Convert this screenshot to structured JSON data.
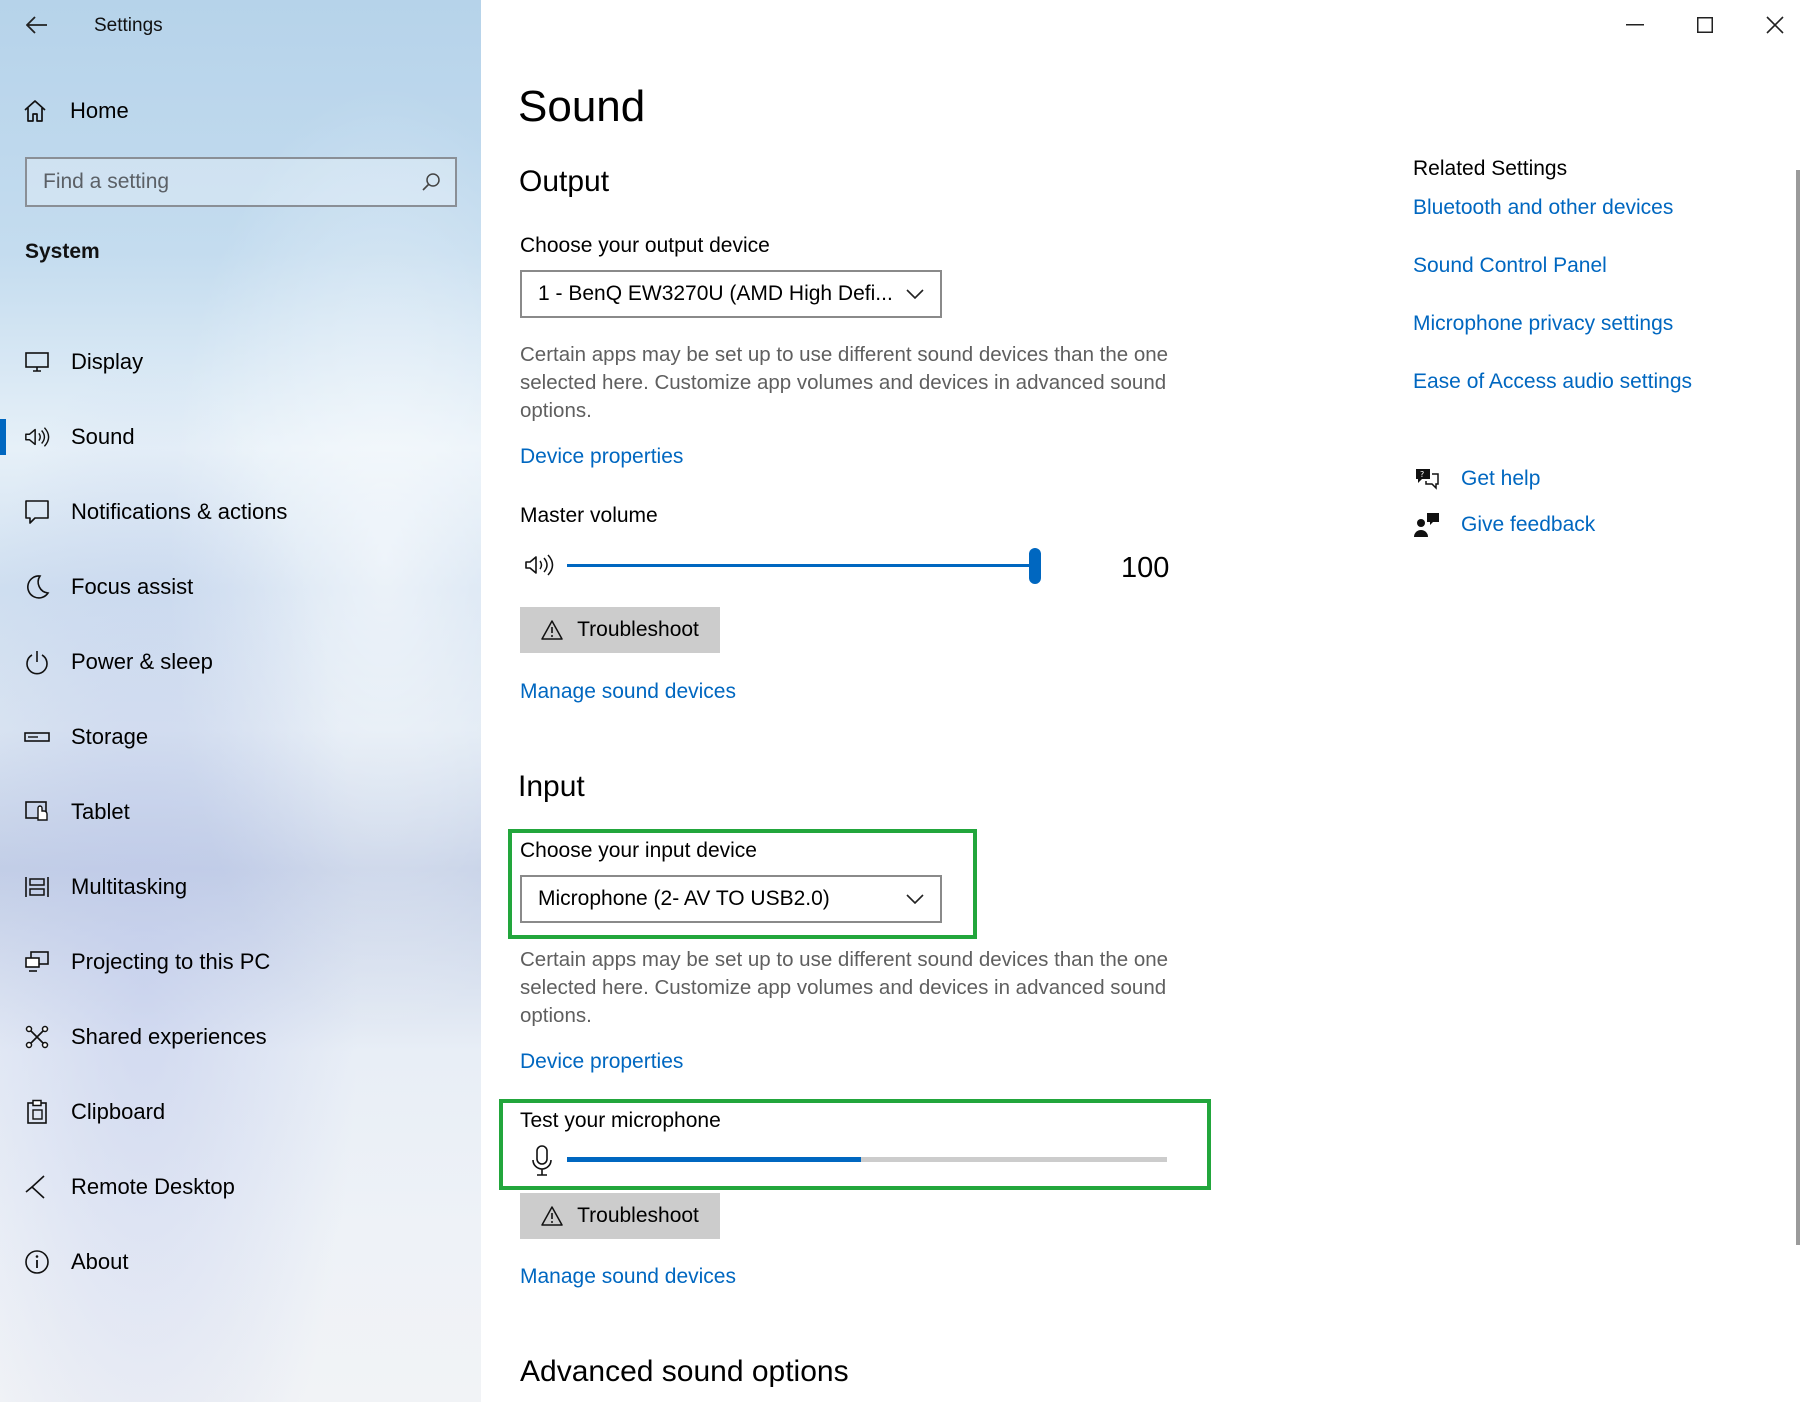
{
  "window": {
    "title": "Settings"
  },
  "sidebar": {
    "home_label": "Home",
    "search_placeholder": "Find a setting",
    "group_title": "System",
    "items": [
      {
        "label": "Display",
        "icon": "monitor-icon"
      },
      {
        "label": "Sound",
        "icon": "speaker-icon",
        "selected": true
      },
      {
        "label": "Notifications & actions",
        "icon": "notification-icon"
      },
      {
        "label": "Focus assist",
        "icon": "moon-icon"
      },
      {
        "label": "Power & sleep",
        "icon": "power-icon"
      },
      {
        "label": "Storage",
        "icon": "storage-icon"
      },
      {
        "label": "Tablet",
        "icon": "tablet-icon"
      },
      {
        "label": "Multitasking",
        "icon": "multitasking-icon"
      },
      {
        "label": "Projecting to this PC",
        "icon": "projecting-icon"
      },
      {
        "label": "Shared experiences",
        "icon": "shared-icon"
      },
      {
        "label": "Clipboard",
        "icon": "clipboard-icon"
      },
      {
        "label": "Remote Desktop",
        "icon": "remote-desktop-icon"
      },
      {
        "label": "About",
        "icon": "info-icon"
      }
    ]
  },
  "main": {
    "title": "Sound",
    "output": {
      "heading": "Output",
      "device_label": "Choose your output device",
      "device_value": "1 - BenQ EW3270U (AMD High Defi...",
      "description": "Certain apps may be set up to use different sound devices than the one selected here. Customize app volumes and devices in advanced sound options.",
      "device_properties": "Device properties",
      "volume_label": "Master volume",
      "volume_value": "100",
      "volume_percent": 100,
      "troubleshoot": "Troubleshoot",
      "manage_devices": "Manage sound devices"
    },
    "input": {
      "heading": "Input",
      "device_label": "Choose your input device",
      "device_value": "Microphone (2- AV TO USB2.0)",
      "description": "Certain apps may be set up to use different sound devices than the one selected here. Customize app volumes and devices in advanced sound options.",
      "device_properties": "Device properties",
      "test_label": "Test your microphone",
      "mic_level_percent": 49,
      "troubleshoot": "Troubleshoot",
      "manage_devices": "Manage sound devices"
    },
    "advanced_heading": "Advanced sound options"
  },
  "related": {
    "title": "Related Settings",
    "links": [
      "Bluetooth and other devices",
      "Sound Control Panel",
      "Microphone privacy settings",
      "Ease of Access audio settings"
    ],
    "get_help": "Get help",
    "give_feedback": "Give feedback"
  },
  "colors": {
    "accent": "#0067c0",
    "highlight": "#22a63c",
    "button_bg": "#cccccc",
    "desc_text": "#5f5f5f"
  }
}
